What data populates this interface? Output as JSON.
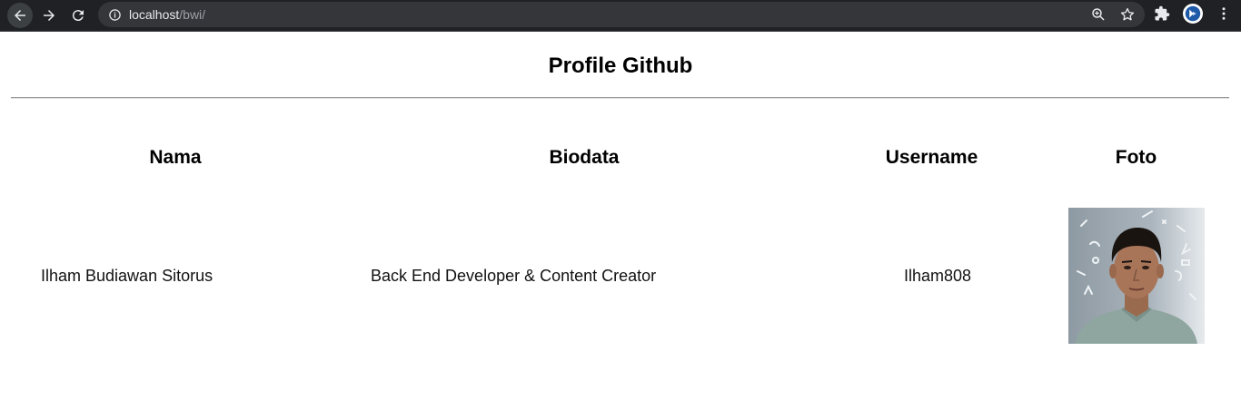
{
  "browser": {
    "url_host": "localhost",
    "url_path": "/bwi/"
  },
  "page": {
    "title": "Profile Github"
  },
  "table": {
    "headers": [
      "Nama",
      "Biodata",
      "Username",
      "Foto"
    ],
    "rows": [
      {
        "nama": "Ilham Budiawan Sitorus",
        "biodata": "Back End Developer & Content Creator",
        "username": "Ilham808"
      }
    ]
  },
  "icons": {
    "back": "arrow-left-icon",
    "forward": "arrow-right-icon",
    "reload": "reload-icon",
    "site_info": "info-icon",
    "zoom": "zoom-icon",
    "bookmark": "star-icon",
    "extensions": "puzzle-icon",
    "profile": "profile-avatar-icon",
    "menu": "kebab-menu-icon"
  },
  "colors": {
    "chrome_bg": "#202124",
    "omnibox_bg": "#35363a",
    "page_bg": "#ffffff"
  }
}
